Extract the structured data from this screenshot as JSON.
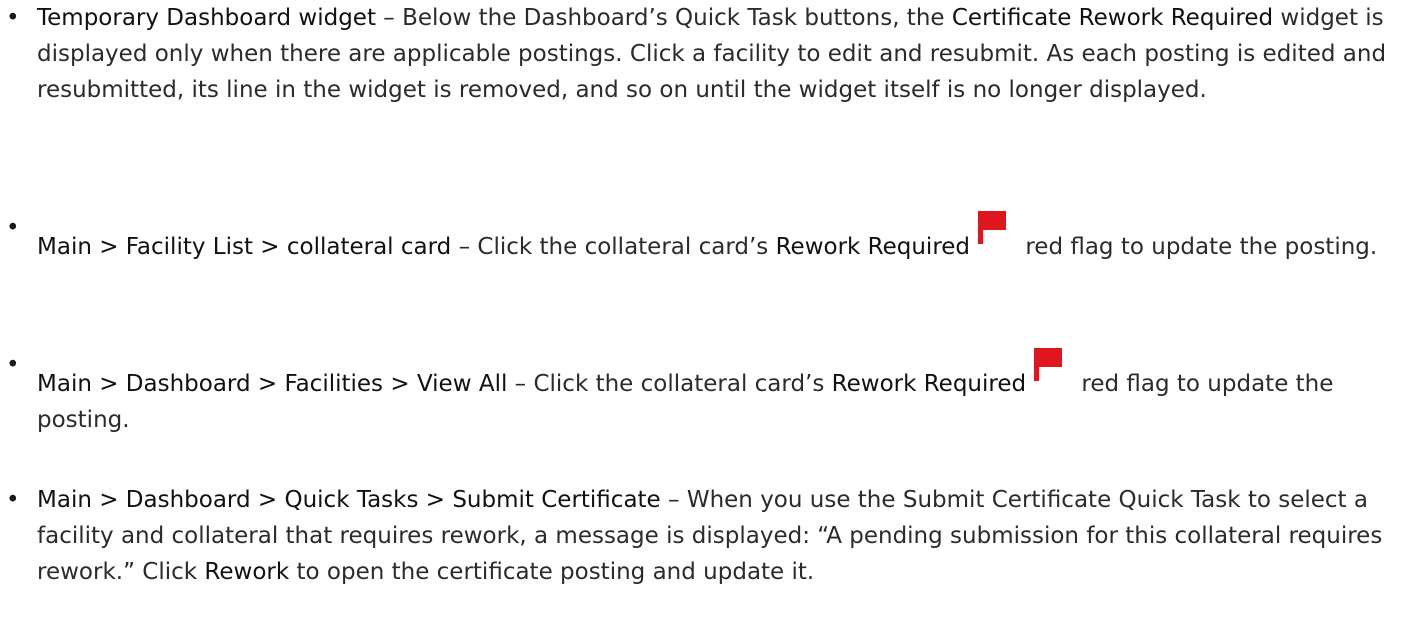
{
  "items": [
    {
      "term": "Temporary Dashboard widget",
      "text_a": " – Below the Dashboard’s Quick Task buttons, the ",
      "term_b": "Certificate Rework Required",
      "text_b": " widget is displayed only when there are applicable postings. Click a facility to edit and resubmit. As each posting is edited and resubmitted, its line in the widget is removed, and so on until the widget itself is no longer displayed."
    },
    {
      "term": "Main > Facility List > collateral card",
      "text_a": " – Click the collateral card’s ",
      "term_b": "Rework Required",
      "text_b": " red flag to update the posting."
    },
    {
      "term": "Main > Dashboard > Facilities > View All",
      "text_a": " – Click the collateral card’s ",
      "term_b": "Rework Required",
      "text_b": " red flag to update the posting."
    },
    {
      "term": "Main > Dashboard > Quick Tasks > Submit Certificate",
      "text_a": " – When you use the Submit Certificate Quick Task to select a facility and collateral that requires rework, a message is displayed: “A pending submission for this collateral requires rework.” Click ",
      "term_b": "Rework",
      "text_b": " to open the certificate posting and update it."
    }
  ],
  "bullet_glyph": "•",
  "icons": {
    "flag": "red-flag-icon"
  },
  "colors": {
    "flag_red": "#e0161e",
    "text": "#2b2b2b"
  }
}
